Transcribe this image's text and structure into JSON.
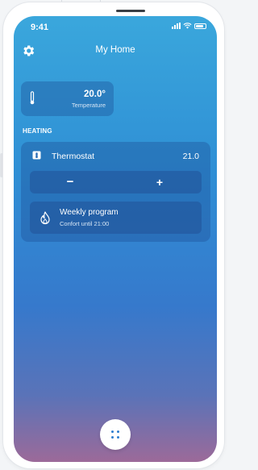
{
  "status_bar": {
    "time": "9:41"
  },
  "header": {
    "title": "My Home"
  },
  "temperature_card": {
    "value": "20.0°",
    "label": "Temperature"
  },
  "section": {
    "heading": "HEATING"
  },
  "heating": {
    "device_name": "Thermostat",
    "setpoint": "21.0",
    "decrease_label": "−",
    "increase_label": "+",
    "program": {
      "name": "Weekly program",
      "status": "Confort until 21:00"
    }
  },
  "colors": {
    "accent": "#2d7fd0",
    "gradient_top": "#3aa7dc",
    "gradient_bottom": "#9c6a99"
  },
  "icons": [
    "settings-gear-icon",
    "thermometer-icon",
    "thermostat-icon",
    "flame-icon",
    "menu-dots-icon",
    "signal-icon",
    "wifi-icon",
    "battery-icon"
  ]
}
